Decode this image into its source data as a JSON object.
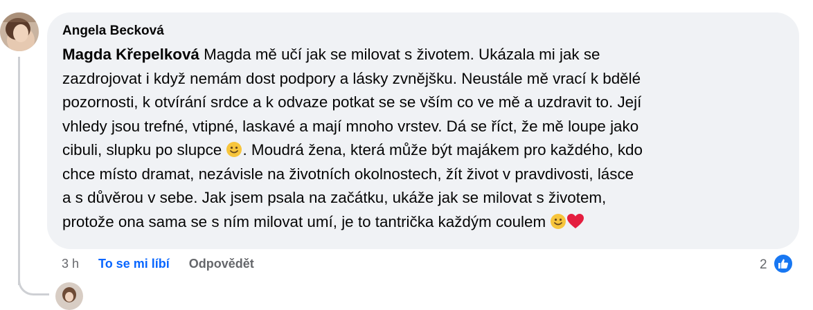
{
  "comment": {
    "author": "Angela Becková",
    "mention": "Magda Křepelková",
    "text_segments": [
      " Magda mě učí jak se milovat s životem. Ukázala mi jak se\nzazdrojovat i když nemám dost podpory a lásky zvnějšku. Neustále mě vrací k bdělé\npozornosti, k otvírání srdce a k odvaze potkat se se vším co ve mě a uzdravit to. Její\nvhledy jsou trefné, vtipné, laskavé a mají mnoho vrstev. Dá se říct, že mě loupe jako\ncibuli, slupku po slupce ",
      ". Moudrá žena, která může být majákem pro každého, kdo\nchce místo dramat, nezávisle na životních okolnostech, žít život v pravdivosti, lásce\na s důvěrou v sebe. Jak jsem psala na začátku, ukáže jak se milovat s životem,\nprotože ona sama se s ním milovat umí, je to tantrička každým coulem "
    ],
    "icons": [
      "smile-emoji",
      "smile-emoji",
      "red-heart-emoji",
      "like-icon"
    ],
    "colors": {
      "bubble": "#f0f2f5",
      "like_link": "#0866ff",
      "secondary_text": "#65676b",
      "like_badge": "#1877f2",
      "heart": "#e41e3f"
    }
  },
  "actions": {
    "time": "3 h",
    "like_label": "To se mi líbí",
    "reply_label": "Odpovědět"
  },
  "reactions": {
    "count": "2"
  }
}
